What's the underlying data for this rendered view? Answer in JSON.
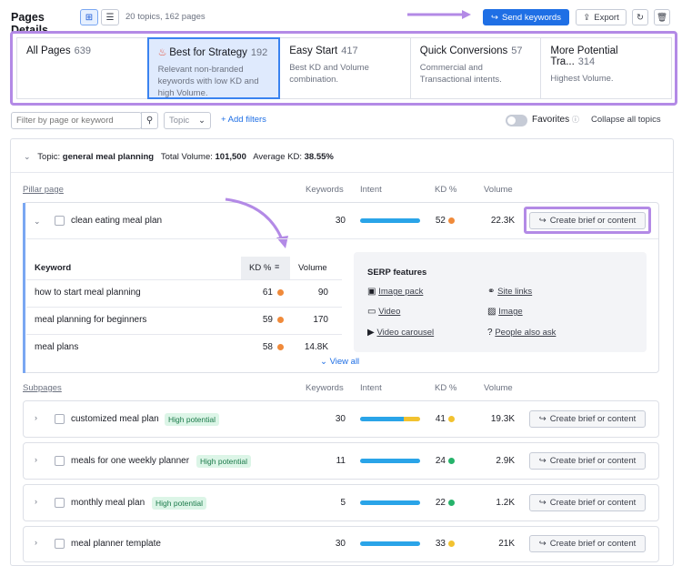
{
  "header": {
    "title": "Pages Details",
    "summary": "20 topics, 162 pages",
    "send_label": "Send keywords",
    "export_label": "Export"
  },
  "cards": [
    {
      "name": "All Pages",
      "count": "639",
      "desc": ""
    },
    {
      "name": "Best for Strategy",
      "count": "192",
      "desc": "Relevant non-branded keywords with low KD and high Volume."
    },
    {
      "name": "Easy Start",
      "count": "417",
      "desc": "Best KD and Volume combination."
    },
    {
      "name": "Quick Conversions",
      "count": "57",
      "desc": "Commercial and Transactional intents."
    },
    {
      "name": "More Potential Tra...",
      "count": "314",
      "desc": "Highest Volume."
    }
  ],
  "filters": {
    "search_placeholder": "Filter by page or keyword",
    "topic_label": "Topic",
    "add_filters": "+ Add filters",
    "favorites": "Favorites",
    "collapse_all": "Collapse all topics"
  },
  "topic": {
    "prefix": "Topic:",
    "name": "general meal planning",
    "volume_label": "Total Volume:",
    "volume": "101,500",
    "kd_label": "Average KD:",
    "kd": "38.55%"
  },
  "columns": {
    "keywords": "Keywords",
    "intent": "Intent",
    "kd": "KD %",
    "volume": "Volume"
  },
  "pillar": {
    "section_label": "Pillar page",
    "keyword": "clean eating meal plan",
    "keywords": "30",
    "kd": "52",
    "volume": "22.3K",
    "kd_color": "#f08a3a",
    "intent_fill": [
      {
        "color": "#2aa4e8",
        "share": 1.0
      }
    ],
    "action": "Create brief or content",
    "inner": {
      "col_keyword": "Keyword",
      "col_kd": "KD %",
      "col_volume": "Volume",
      "rows": [
        {
          "keyword": "how to start meal planning",
          "kd": "61",
          "volume": "90",
          "kd_color": "#f08a3a"
        },
        {
          "keyword": "meal planning for beginners",
          "kd": "59",
          "volume": "170",
          "kd_color": "#f08a3a"
        },
        {
          "keyword": "meal plans",
          "kd": "58",
          "volume": "14.8K",
          "kd_color": "#f08a3a"
        }
      ],
      "view_all": "View all"
    },
    "serp": {
      "title": "SERP features",
      "items": [
        "Image pack",
        "Site links",
        "Video",
        "Image",
        "Video carousel",
        "People also ask"
      ]
    }
  },
  "subpages": {
    "section_label": "Subpages",
    "rows": [
      {
        "keyword": "customized meal plan",
        "badge": "High potential",
        "keywords": "30",
        "kd": "41",
        "volume": "19.3K",
        "kd_color": "#f2c230",
        "intent_fill": [
          {
            "color": "#2aa4e8",
            "share": 0.72
          },
          {
            "color": "#f2c230",
            "share": 0.28
          }
        ],
        "action": "Create brief or content"
      },
      {
        "keyword": "meals for one weekly planner",
        "badge": "High potential",
        "keywords": "11",
        "kd": "24",
        "volume": "2.9K",
        "kd_color": "#26b36b",
        "intent_fill": [
          {
            "color": "#2aa4e8",
            "share": 1.0
          }
        ],
        "action": "Create brief or content"
      },
      {
        "keyword": "monthly meal plan",
        "badge": "High potential",
        "keywords": "5",
        "kd": "22",
        "volume": "1.2K",
        "kd_color": "#26b36b",
        "intent_fill": [
          {
            "color": "#2aa4e8",
            "share": 1.0
          }
        ],
        "action": "Create brief or content"
      },
      {
        "keyword": "meal planner template",
        "badge": "",
        "keywords": "30",
        "kd": "33",
        "volume": "21K",
        "kd_color": "#f2c230",
        "intent_fill": [
          {
            "color": "#2aa4e8",
            "share": 1.0
          }
        ],
        "action": "Create brief or content"
      }
    ]
  },
  "colors": {
    "accent": "#1f6fe5",
    "highlight": "#b38ae6",
    "selected_card": "#dfeafd"
  }
}
